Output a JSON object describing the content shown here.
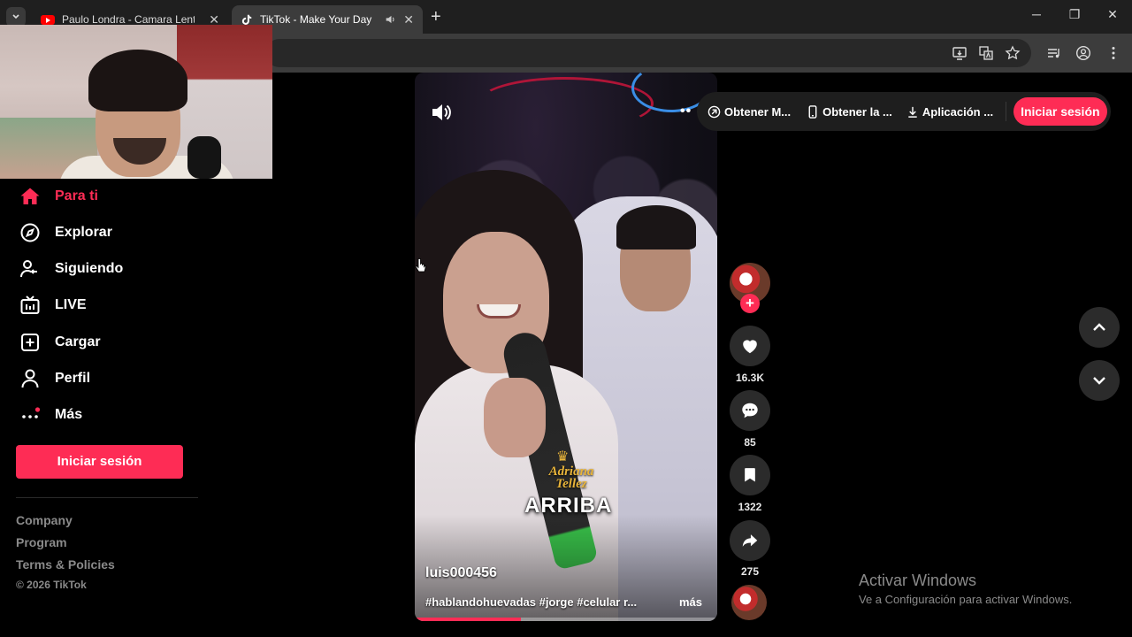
{
  "browser": {
    "tabs": [
      {
        "title": "Paulo Londra - Camara Lenta (C",
        "favicon": "youtube-icon",
        "active": false
      },
      {
        "title": "TikTok - Make Your Day",
        "favicon": "tiktok-icon",
        "active": true
      }
    ],
    "new_tab_symbol": "+",
    "window_controls": {
      "minimize": "─",
      "restore": "❐",
      "close": "✕"
    }
  },
  "sidebar": {
    "items": [
      {
        "label": "Para ti",
        "icon": "home-icon",
        "active": true
      },
      {
        "label": "Explorar",
        "icon": "compass-icon",
        "active": false
      },
      {
        "label": "Siguiendo",
        "icon": "following-icon",
        "active": false
      },
      {
        "label": "LIVE",
        "icon": "live-icon",
        "active": false
      },
      {
        "label": "Cargar",
        "icon": "upload-icon",
        "active": false
      },
      {
        "label": "Perfil",
        "icon": "profile-icon",
        "active": false
      },
      {
        "label": "Más",
        "icon": "more-icon",
        "active": false
      }
    ],
    "login_label": "Iniciar sesión",
    "footer_links": [
      "Company",
      "Program",
      "Terms & Policies"
    ],
    "copyright": "© 2026 TikTok"
  },
  "topbar": {
    "items": [
      {
        "label": "Obtener M...",
        "icon": "coin-icon"
      },
      {
        "label": "Obtener la ...",
        "icon": "phone-icon"
      },
      {
        "label": "Aplicación ...",
        "icon": "download-icon"
      }
    ],
    "login_label": "Iniciar sesión"
  },
  "video": {
    "author": "luis000456",
    "description": "#hablandohuevadas #jorge #celular r...",
    "more_label": "más",
    "caption_overlay": "ARRIBA",
    "watermark_brand": "Adriana Tellez",
    "progress": 0.35
  },
  "actions": {
    "likes": "16.3K",
    "comments": "85",
    "saves": "1322",
    "shares": "275"
  },
  "windows_activation": {
    "title": "Activar Windows",
    "subtitle": "Ve a Configuración para activar Windows."
  },
  "colors": {
    "accent": "#fe2c55",
    "background": "#000000",
    "chrome_dark": "#1f1f1f",
    "chrome_toolbar": "#3c3c3c"
  }
}
